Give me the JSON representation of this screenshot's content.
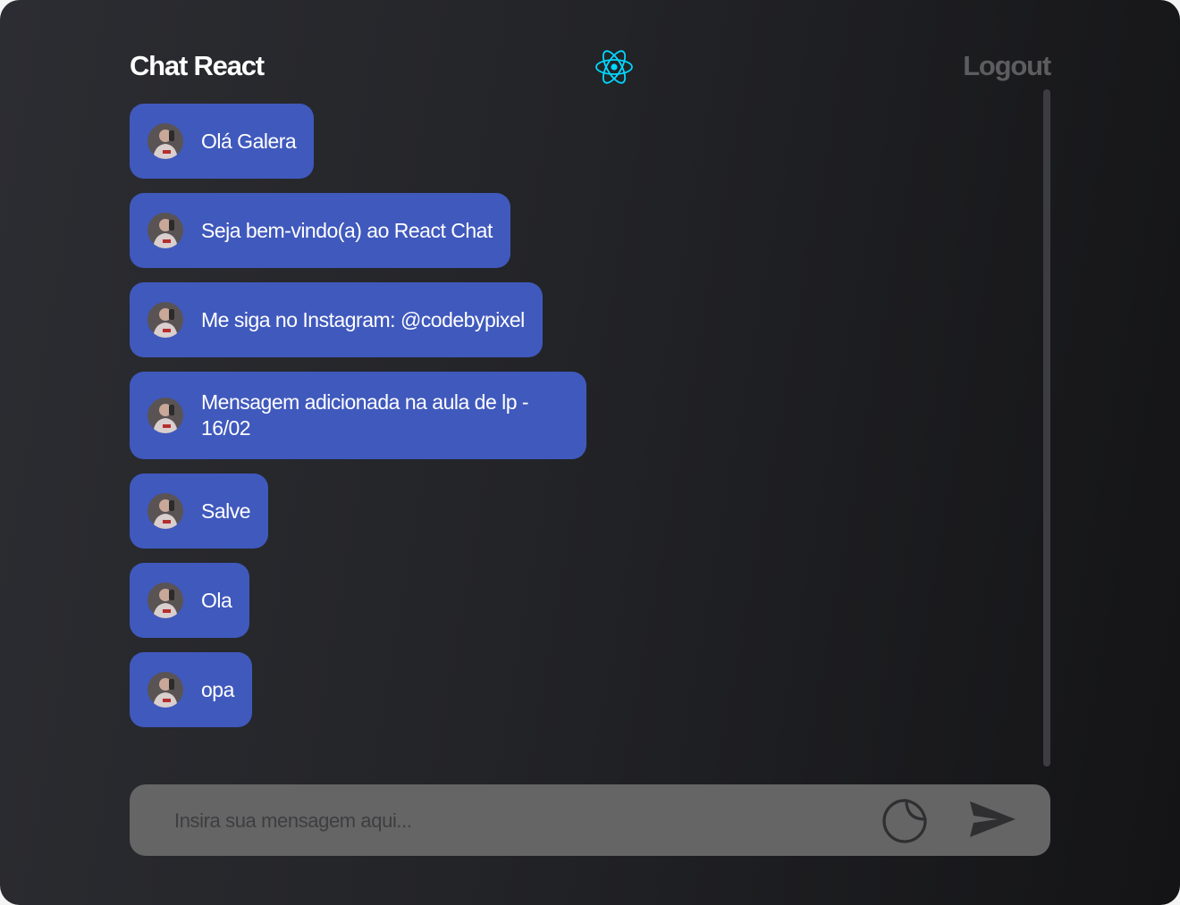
{
  "header": {
    "title": "Chat React",
    "logo_icon": "react-logo-icon",
    "logout_label": "Logout"
  },
  "messages": [
    {
      "text": "Olá Galera",
      "avatar": "user-avatar"
    },
    {
      "text": "Seja bem-vindo(a) ao React Chat",
      "avatar": "user-avatar"
    },
    {
      "text": "Me siga no Instagram: @codebypixel",
      "avatar": "user-avatar"
    },
    {
      "text": "Mensagem adicionada na aula de lp - 16/02",
      "avatar": "user-avatar"
    },
    {
      "text": "Salve",
      "avatar": "user-avatar"
    },
    {
      "text": "Ola",
      "avatar": "user-avatar"
    },
    {
      "text": "opa",
      "avatar": "user-avatar"
    }
  ],
  "composer": {
    "placeholder": "Insira sua mensagem aqui...",
    "value": "",
    "sticker_icon": "sticker-icon",
    "send_icon": "send-icon"
  },
  "colors": {
    "bubble": "#4059bd",
    "react_accent": "#00d8ff",
    "composer_bg": "#656566",
    "logout": "#5d5d5f"
  }
}
